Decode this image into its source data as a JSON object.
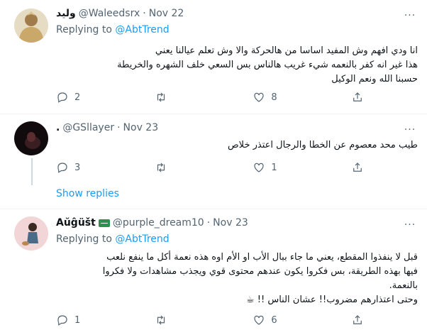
{
  "tweets": [
    {
      "name": "وليد",
      "handle": "@Waleedsrx",
      "dot": "·",
      "time": "Nov 22",
      "replying_prefix": "Replying to ",
      "replying_to": "@AbtTrend",
      "lines": [
        "انا ودي افهم وش المفيد اساسا من هالحركة والا وش تعلم عيالنا يعني",
        "هذا غير انه كفر بالنعمه شيء غريب هالناس بس السعي خلف الشهره والخريطة",
        "حسبنا الله ونعم الوكيل"
      ],
      "replies": "2",
      "retweets": "",
      "likes": "8"
    },
    {
      "name": ".",
      "handle": "@GSllayer",
      "dot": "·",
      "time": "Nov 23",
      "lines": [
        "طيب محد معصوم عن الخطا والرجال اعتذر خلاص"
      ],
      "replies": "3",
      "retweets": "",
      "likes": "1"
    },
    {
      "name": "Aŭĝüšt",
      "handle": "@purple_dream10",
      "dot": "·",
      "time": "Nov 23",
      "replying_prefix": "Replying to ",
      "replying_to": "@AbtTrend",
      "lines": [
        "قبل لا ينفذوا المقطع، يعني ما جاء ببال الأب او الأم اوه هذه نعمة أكل ما ينفع نلعب",
        "فيها بهذه الطريقة، بس فكروا يكون عندهم محتوى قوي ويجذب مشاهدات ولا فكروا",
        "بالنعمة.",
        "وحتى اعتذارهم مضروب!! عشان الناس !! ☕"
      ],
      "replies": "1",
      "retweets": "",
      "likes": "6"
    }
  ],
  "show_replies": "Show replies",
  "more_glyph": "···",
  "colors": {
    "link": "#1d9bf0",
    "secondary": "#536471",
    "divider": "#eff3f4",
    "text": "#0f1419"
  }
}
